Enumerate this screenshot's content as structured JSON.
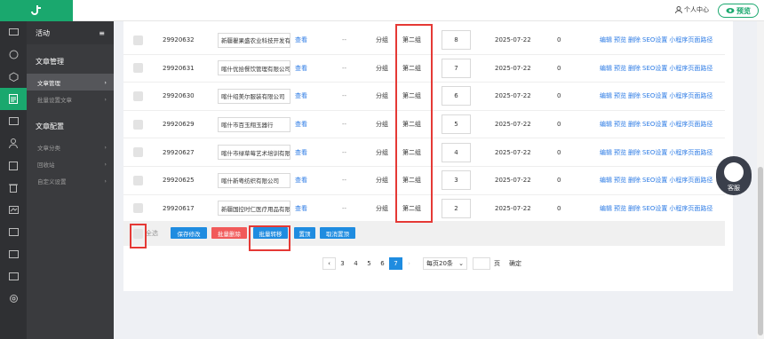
{
  "topbar": {
    "logo": "Ꭾ",
    "user_label": "个人中心",
    "preview_label": "预览"
  },
  "rail": {
    "icons": [
      "monitor-icon",
      "palette-icon",
      "cube-icon",
      "document-icon",
      "image-icon",
      "person-icon",
      "clipboard-icon",
      "trash-icon",
      "chart-icon",
      "list-icon",
      "card-icon",
      "window-icon",
      "gear-icon"
    ]
  },
  "sidebar": {
    "header": "活动",
    "section1": "文章管理",
    "items1": [
      {
        "label": "文章管理",
        "active": true
      },
      {
        "label": "批量设置文章"
      }
    ],
    "section2": "文章配置",
    "items2": [
      {
        "label": "文章分类"
      },
      {
        "label": "回收站"
      },
      {
        "label": "自定义设置"
      }
    ]
  },
  "table": {
    "rows": [
      {
        "id": "29920632",
        "name": "新疆瞿果盛农业科技开发有",
        "view": "查看",
        "dash": "--",
        "type": "分组",
        "group": "第二组",
        "sort": "8",
        "date": "2025-07-22",
        "count": "0"
      },
      {
        "id": "29920631",
        "name": "喀什优拾餐饮管理有限公司",
        "view": "查看",
        "dash": "--",
        "type": "分组",
        "group": "第二组",
        "sort": "7",
        "date": "2025-07-22",
        "count": "0"
      },
      {
        "id": "29920630",
        "name": "喀什绍美尔服装有限公司",
        "view": "查看",
        "dash": "--",
        "type": "分组",
        "group": "第二组",
        "sort": "6",
        "date": "2025-07-22",
        "count": "0"
      },
      {
        "id": "29920629",
        "name": "喀什市百玉翔玉器行",
        "view": "查看",
        "dash": "--",
        "type": "分组",
        "group": "第二组",
        "sort": "5",
        "date": "2025-07-22",
        "count": "0"
      },
      {
        "id": "29920627",
        "name": "喀什市绿草莓艺术培训有限",
        "view": "查看",
        "dash": "--",
        "type": "分组",
        "group": "第二组",
        "sort": "4",
        "date": "2025-07-22",
        "count": "0"
      },
      {
        "id": "29920625",
        "name": "喀什新粤纺织有限公司",
        "view": "查看",
        "dash": "--",
        "type": "分组",
        "group": "第二组",
        "sort": "3",
        "date": "2025-07-22",
        "count": "0"
      },
      {
        "id": "29920617",
        "name": "新疆国控时仁医疗用品有限",
        "view": "查看",
        "dash": "--",
        "type": "分组",
        "group": "第二组",
        "sort": "2",
        "date": "2025-07-22",
        "count": "0"
      }
    ],
    "ops": [
      "编辑",
      "预览",
      "删除",
      "SEO设置",
      "小程序页面路径"
    ]
  },
  "footer": {
    "select_all": "全选",
    "save": "保存修改",
    "batch_delete": "批量删除",
    "batch_move": "批量转移",
    "pin": "置顶",
    "unpin": "取消置顶"
  },
  "pager": {
    "pages": [
      "3",
      "4",
      "5",
      "6",
      "7"
    ],
    "current": "7",
    "page_size": "每页20条",
    "page_unit": "页",
    "confirm": "确定"
  },
  "float": {
    "kefu": "客服"
  },
  "colors": {
    "accent": "#1aa86e",
    "link": "#2c7be5",
    "primary": "#1f8ce0",
    "danger": "#f15a5a",
    "highlight": "#e53935"
  }
}
